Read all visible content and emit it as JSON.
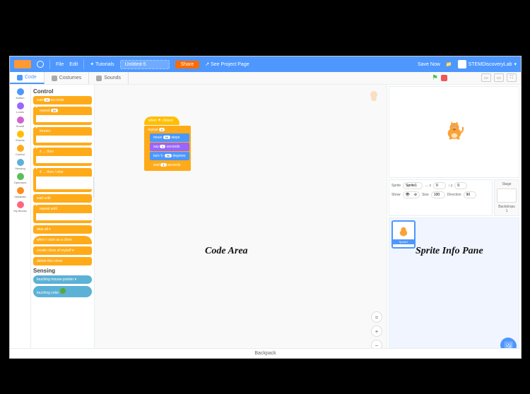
{
  "menubar": {
    "globe_icon": "globe-icon",
    "file_label": "File",
    "edit_label": "Edit",
    "tutorials_label": "Tutorials",
    "project_title": "Untitled-5",
    "share_label": "Share",
    "see_project_label": "See Project Page",
    "save_now_label": "Save Now",
    "backpack_icon": "folder-icon",
    "username": "STEMDiscoveryLab",
    "username_dropdown": "▾"
  },
  "tabs": {
    "code_label": "Code",
    "costumes_label": "Costumes",
    "sounds_label": "Sounds"
  },
  "stage_controls": {
    "flag": "⚑",
    "fullscreen": "⛶"
  },
  "categories": [
    {
      "label": "Motion",
      "color": "#4c97ff"
    },
    {
      "label": "Looks",
      "color": "#9966ff"
    },
    {
      "label": "Sound",
      "color": "#cf63cf"
    },
    {
      "label": "Events",
      "color": "#ffbf00"
    },
    {
      "label": "Control",
      "color": "#ffab19"
    },
    {
      "label": "Sensing",
      "color": "#5cb1d6"
    },
    {
      "label": "Operators",
      "color": "#59c059"
    },
    {
      "label": "Variables",
      "color": "#ff8c1a"
    },
    {
      "label": "My Blocks",
      "color": "#ff6680"
    }
  ],
  "palette": {
    "header_control": "Control",
    "wait_block": "wait",
    "wait_val": "1",
    "wait_suffix": "seconds",
    "repeat_block": "repeat",
    "repeat_val": "10",
    "forever_block": "forever",
    "if_block": "if … then",
    "if_else_block": "if … then / else",
    "wait_until_block": "wait until",
    "repeat_until_block": "repeat until",
    "stop_block": "stop",
    "stop_option": "all ▾",
    "when_clone_block": "when I start as a clone",
    "create_clone_block": "create clone of",
    "create_clone_option": "myself ▾",
    "delete_clone_block": "delete this clone",
    "header_sensing": "Sensing",
    "touching_block": "touching",
    "touching_option": "mouse-pointer ▾",
    "touching_color_block": "touching color"
  },
  "script": {
    "hat": "when ⚑ clicked",
    "repeat": "repeat",
    "repeat_val": "4",
    "move": "move",
    "move_val": "50",
    "move_suffix": "steps",
    "say_label": "say",
    "say_val": "1",
    "say_suffix": "seconds",
    "turn": "turn ↻",
    "turn_val": "90",
    "turn_suffix": "degrees",
    "wait_label": "wait",
    "wait_val": "1",
    "wait_suffix": "seconds"
  },
  "sprite_info": {
    "sprite_label": "Sprite",
    "sprite_name": "Sprite1",
    "x_icon": "↔ x",
    "x_val": "0",
    "y_icon": "↕ y",
    "y_val": "0",
    "show_label": "Show",
    "show_visible": "👁",
    "show_hidden": "⊘",
    "size_label": "Size",
    "size_val": "100",
    "direction_label": "Direction",
    "direction_val": "90"
  },
  "stage_selector": {
    "stage_label": "Stage",
    "backdrops_label": "Backdrops",
    "backdrops_count": "1"
  },
  "sprites": [
    {
      "name": "Sprite1"
    }
  ],
  "zoom": {
    "plus": "+",
    "minus": "−",
    "reset": "="
  },
  "backpack_label": "Backpack",
  "annotations": {
    "code_area": "Code Area",
    "sprite_info_pane": "Sprite Info Pane"
  }
}
